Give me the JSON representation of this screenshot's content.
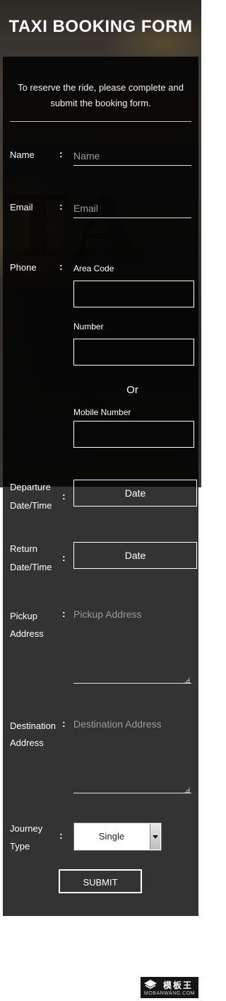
{
  "header": {
    "title": "TAXI BOOKING FORM"
  },
  "intro": "To reserve the ride, please complete and submit the booking form.",
  "colon": ":",
  "fields": {
    "name": {
      "label": "Name",
      "placeholder": "Name",
      "value": ""
    },
    "email": {
      "label": "Email",
      "placeholder": "Email",
      "value": ""
    },
    "phone": {
      "label": "Phone",
      "area_code_label": "Area Code",
      "number_label": "Number",
      "or_text": "Or",
      "mobile_label": "Mobile Number"
    },
    "departure": {
      "label_line1": "Departure",
      "label_line2": "Date/Time",
      "button_text": "Date"
    },
    "return": {
      "label_line1": "Return",
      "label_line2": "Date/Time",
      "button_text": "Date"
    },
    "pickup": {
      "label_line1": "Pickup",
      "label_line2": "Address",
      "placeholder": "Pickup Address"
    },
    "destination": {
      "label_line1": "Destination",
      "label_line2": "Address",
      "placeholder": "Destination Address"
    },
    "journey": {
      "label_line1": "Journey",
      "label_line2": "Type",
      "selected": "Single"
    }
  },
  "submit_label": "SUBMIT",
  "watermark": {
    "brand": "模板王",
    "url": "MOBANWANG.COM"
  },
  "colors": {
    "panel_dark": "#000000",
    "panel_grey": "#333333",
    "text": "#ffffff",
    "placeholder": "#9a9a9a"
  }
}
